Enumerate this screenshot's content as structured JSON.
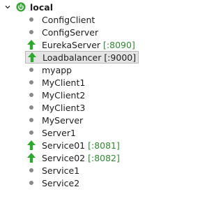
{
  "tree": {
    "root": {
      "label": "local",
      "icon": "spring-boot-power-icon",
      "expanded": true
    },
    "items": [
      {
        "name": "ConfigClient",
        "port": "",
        "state": "stopped"
      },
      {
        "name": "ConfigServer",
        "port": "",
        "state": "stopped"
      },
      {
        "name": "EurekaServer",
        "port": "[:8090]",
        "state": "running"
      },
      {
        "name": "Loadbalancer",
        "port": "[:9000]",
        "state": "running",
        "selected": true
      },
      {
        "name": "myapp",
        "port": "",
        "state": "stopped"
      },
      {
        "name": "MyClient1",
        "port": "",
        "state": "stopped"
      },
      {
        "name": "MyClient2",
        "port": "",
        "state": "stopped"
      },
      {
        "name": "MyClient3",
        "port": "",
        "state": "stopped"
      },
      {
        "name": "MyServer",
        "port": "",
        "state": "stopped"
      },
      {
        "name": "Server1",
        "port": "",
        "state": "stopped"
      },
      {
        "name": "Service01",
        "port": "[:8081]",
        "state": "running"
      },
      {
        "name": "Service02",
        "port": "[:8082]",
        "state": "running"
      },
      {
        "name": "Service1",
        "port": "",
        "state": "stopped"
      },
      {
        "name": "Service2",
        "port": "",
        "state": "stopped"
      }
    ]
  },
  "colors": {
    "running": "#2fa82f",
    "stopped": "#8a8a8a",
    "port_text": "#2f8a2f",
    "selection_bg": "#e4e4e4",
    "boot_icon": "#3aa53a"
  }
}
